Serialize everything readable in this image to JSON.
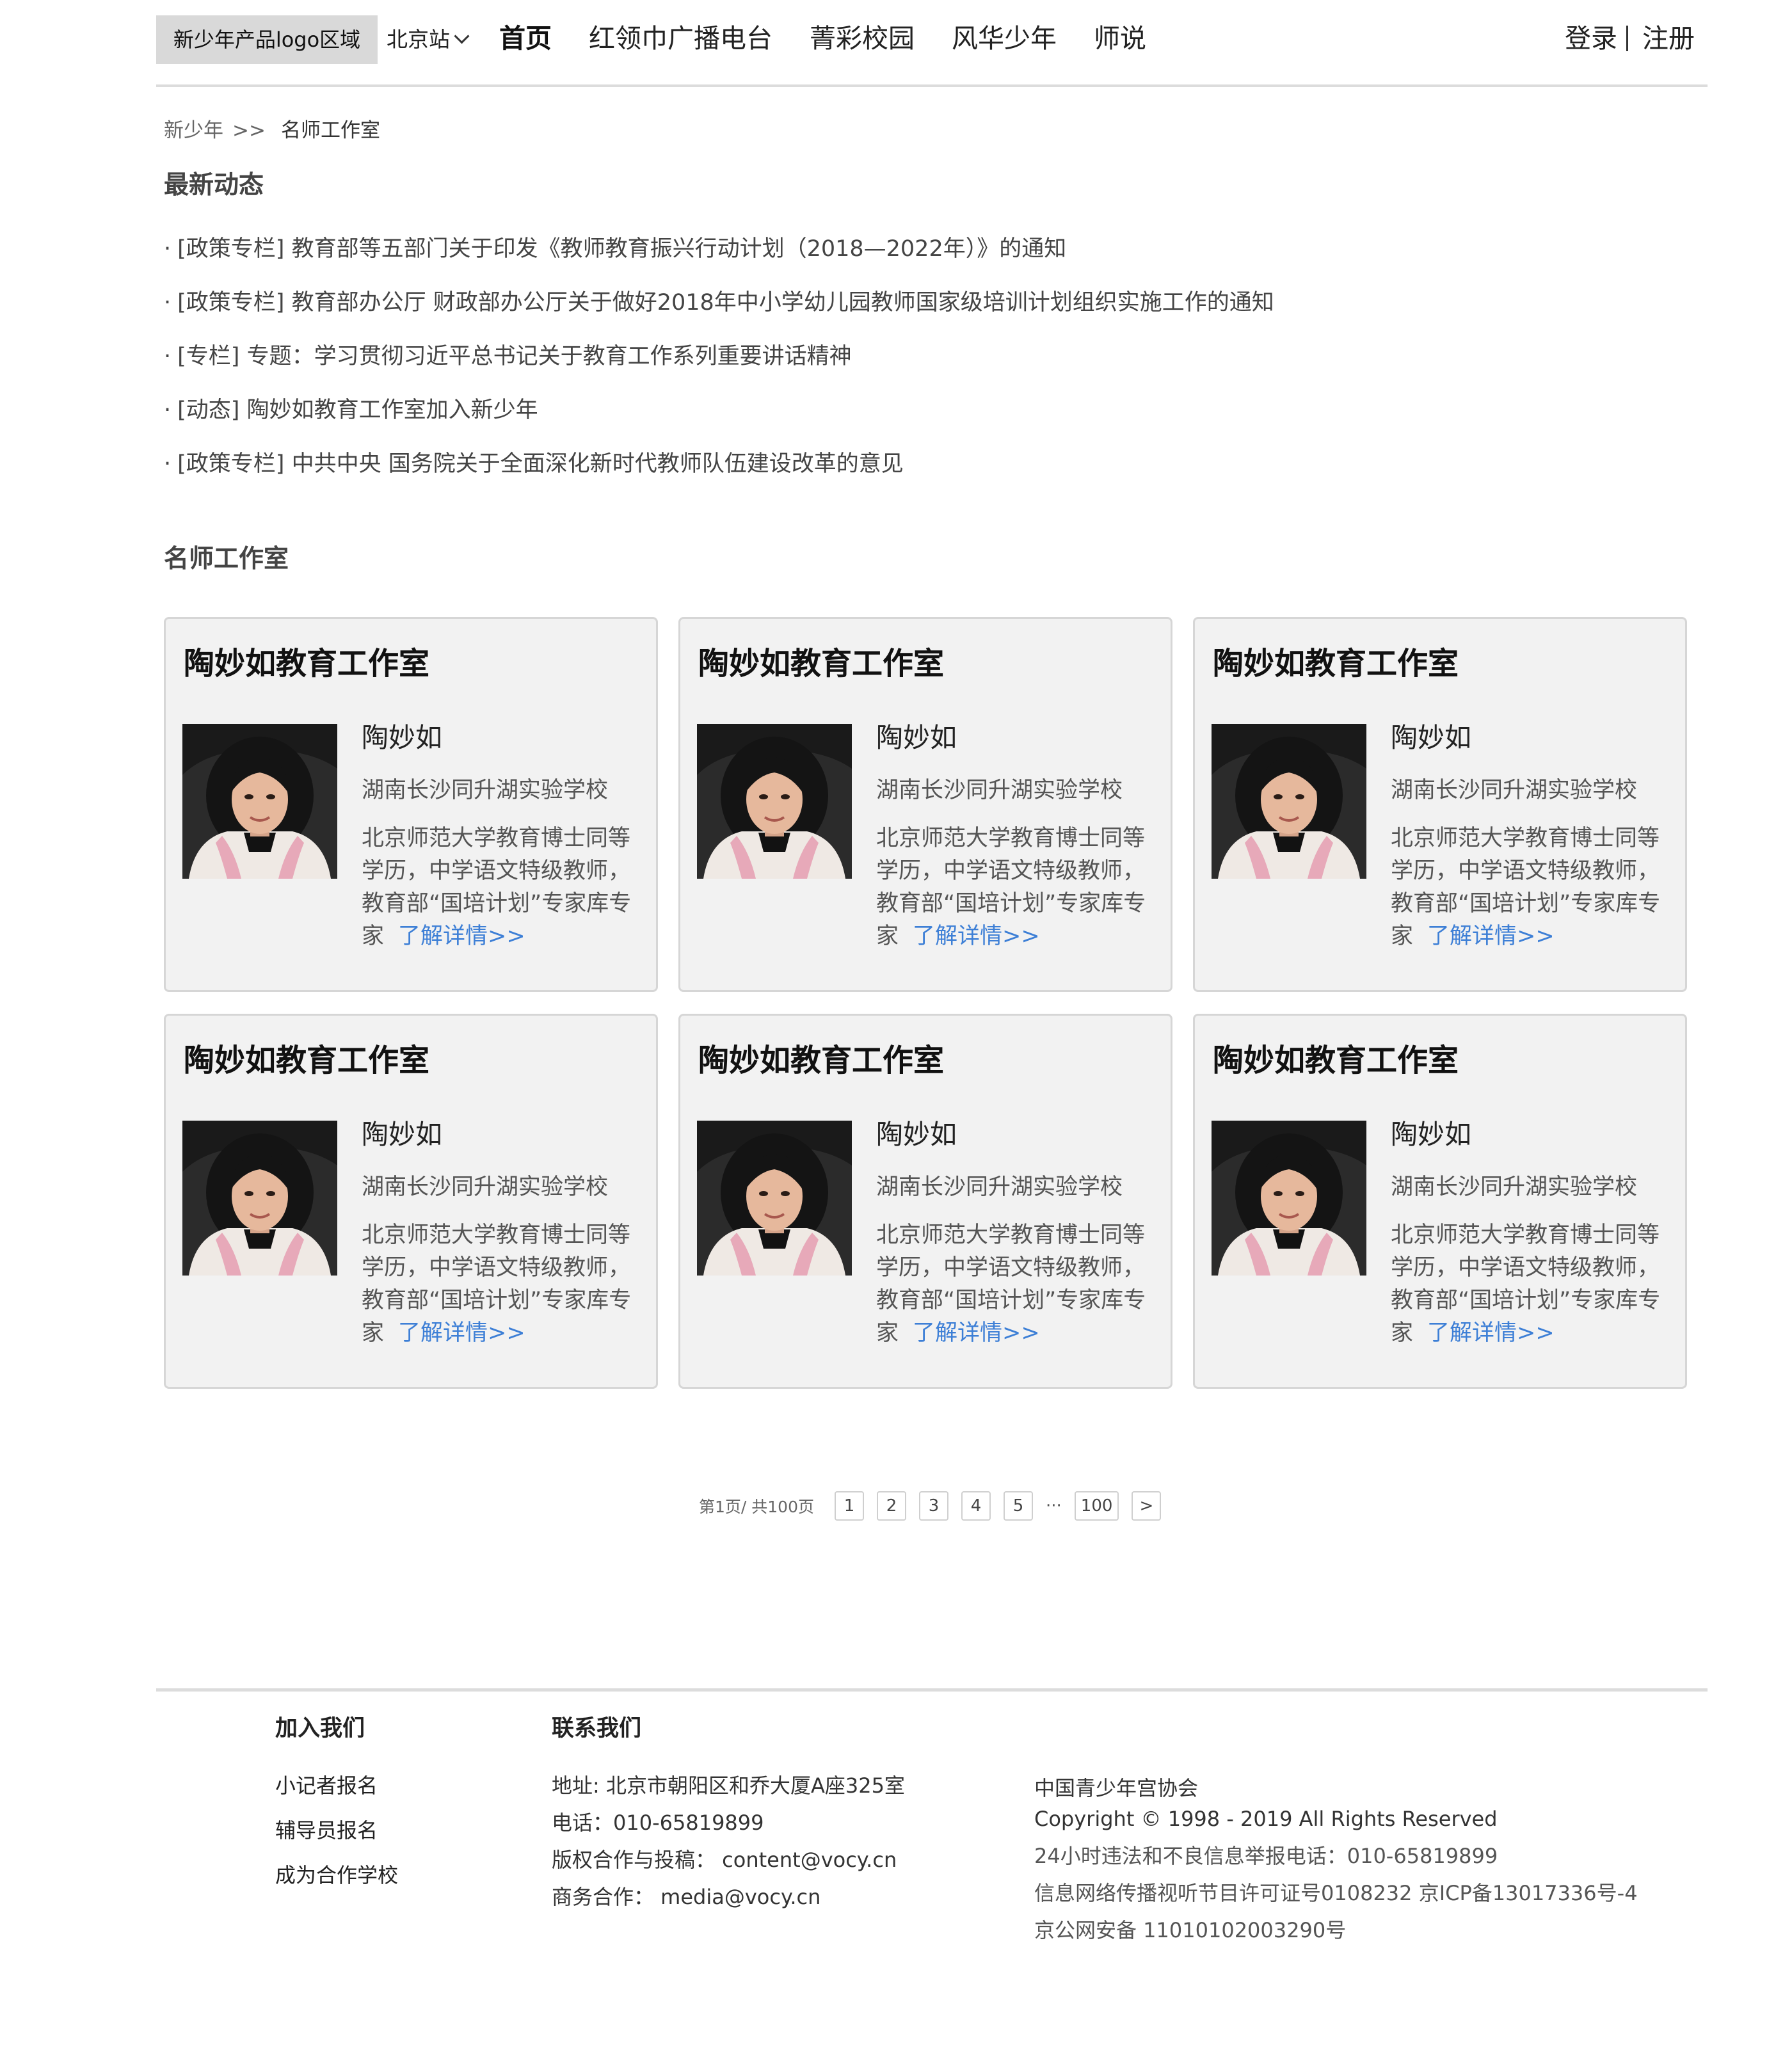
{
  "header": {
    "logo_label": "新少年产品logo区域",
    "city": "北京站",
    "nav": [
      "首页",
      "红领巾广播电台",
      "菁彩校园",
      "风华少年",
      "师说"
    ],
    "login": "登录",
    "register": "注册"
  },
  "breadcrumb": {
    "home": "新少年",
    "separator": ">>",
    "current": "名师工作室"
  },
  "news": {
    "title": "最新动态",
    "bullet": "·",
    "items": [
      "[政策专栏] 教育部等五部门关于印发《教师教育振兴行动计划（2018—2022年）》的通知",
      "[政策专栏] 教育部办公厅 财政部办公厅关于做好2018年中小学幼儿园教师国家级培训计划组织实施工作的通知",
      "[专栏] 专题：学习贯彻习近平总书记关于教育工作系列重要讲话精神",
      "[动态] 陶妙如教育工作室加入新少年",
      "[政策专栏] 中共中央 国务院关于全面深化新时代教师队伍建设改革的意见"
    ]
  },
  "studios": {
    "title": "名师工作室",
    "cards": [
      {
        "title": "陶妙如教育工作室",
        "name": "陶妙如",
        "school": "湖南长沙同升湖实验学校",
        "desc": "北京师范大学教育博士同等学历，中学语文特级教师，教育部“国培计划”专家库专家",
        "more": "了解详情>>"
      },
      {
        "title": "陶妙如教育工作室",
        "name": "陶妙如",
        "school": "湖南长沙同升湖实验学校",
        "desc": "北京师范大学教育博士同等学历，中学语文特级教师，教育部“国培计划”专家库专家",
        "more": "了解详情>>"
      },
      {
        "title": "陶妙如教育工作室",
        "name": "陶妙如",
        "school": "湖南长沙同升湖实验学校",
        "desc": "北京师范大学教育博士同等学历，中学语文特级教师，教育部“国培计划”专家库专家",
        "more": "了解详情>>"
      },
      {
        "title": "陶妙如教育工作室",
        "name": "陶妙如",
        "school": "湖南长沙同升湖实验学校",
        "desc": "北京师范大学教育博士同等学历，中学语文特级教师，教育部“国培计划”专家库专家",
        "more": "了解详情>>"
      },
      {
        "title": "陶妙如教育工作室",
        "name": "陶妙如",
        "school": "湖南长沙同升湖实验学校",
        "desc": "北京师范大学教育博士同等学历，中学语文特级教师，教育部“国培计划”专家库专家",
        "more": "了解详情>>"
      },
      {
        "title": "陶妙如教育工作室",
        "name": "陶妙如",
        "school": "湖南长沙同升湖实验学校",
        "desc": "北京师范大学教育博士同等学历，中学语文特级教师，教育部“国培计划”专家库专家",
        "more": "了解详情>>"
      }
    ]
  },
  "pagination": {
    "info": "第1页/ 共100页",
    "pages": [
      "1",
      "2",
      "3",
      "4",
      "5"
    ],
    "ellipsis": "···",
    "last": "100",
    "next": ">"
  },
  "footer": {
    "join": {
      "title": "加入我们",
      "links": [
        "小记者报名",
        "辅导员报名",
        "成为合作学校"
      ]
    },
    "contact": {
      "title": "联系我们",
      "lines": [
        "地址: 北京市朝阳区和乔大厦A座325室",
        "电话：010-65819899",
        "版权合作与投稿：  content@vocy.cn",
        "商务合作：  media@vocy.cn"
      ]
    },
    "legal": {
      "org": "中国青少年宫协会",
      "copyright": "Copyright © 1998 - 2019 All Rights Reserved",
      "lines": [
        "24小时违法和不良信息举报电话：010-65819899",
        "信息网络传播视听节目许可证号0108232 京ICP备13017336号-4",
        "京公网安备 11010102003290号"
      ]
    }
  },
  "colors": {
    "link_blue": "#3d7fd6",
    "card_bg": "#f2f2f2",
    "logo_bg": "#d9d9d9",
    "divider": "#dcdcdc"
  }
}
